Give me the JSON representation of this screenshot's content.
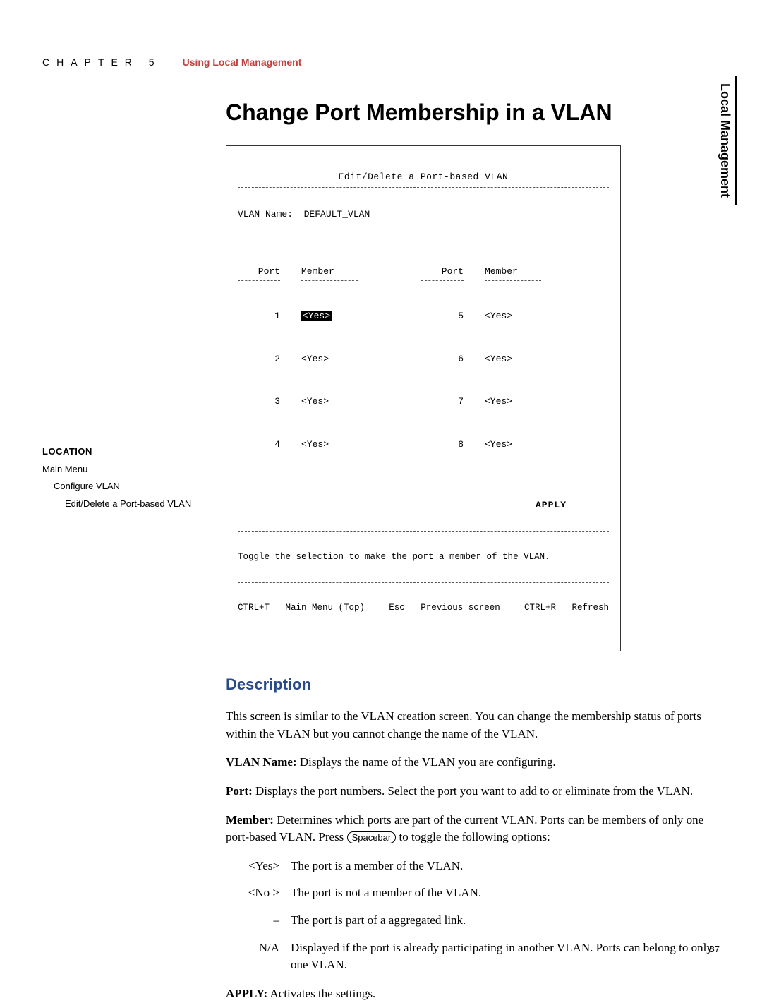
{
  "header": {
    "chapter_label": "CHAPTER 5",
    "chapter_topic": "Using Local Management"
  },
  "side_tab": "Local Management",
  "title": "Change Port Membership in a VLAN",
  "terminal": {
    "screen_title": "Edit/Delete a Port-based VLAN",
    "vlan_name_label": "VLAN Name:",
    "vlan_name_value": "DEFAULT_VLAN",
    "port_header": "Port",
    "member_header": "Member",
    "left_ports": [
      {
        "port": "1",
        "member": "<Yes>",
        "selected": true
      },
      {
        "port": "2",
        "member": "<Yes>"
      },
      {
        "port": "3",
        "member": "<Yes>"
      },
      {
        "port": "4",
        "member": "<Yes>"
      }
    ],
    "right_ports": [
      {
        "port": "5",
        "member": "<Yes>"
      },
      {
        "port": "6",
        "member": "<Yes>"
      },
      {
        "port": "7",
        "member": "<Yes>"
      },
      {
        "port": "8",
        "member": "<Yes>"
      }
    ],
    "apply_label": "APPLY",
    "hint": "Toggle the selection to make the port a member of the VLAN.",
    "nav_left": "CTRL+T = Main Menu (Top)",
    "nav_mid": "Esc = Previous screen",
    "nav_right": "CTRL+R = Refresh"
  },
  "description_heading": "Description",
  "location": {
    "heading": "LOCATION",
    "lvl1": "Main Menu",
    "lvl2": "Configure VLAN",
    "lvl3": "Edit/Delete a Port-based VLAN"
  },
  "desc": {
    "intro": "This screen is similar to the VLAN creation screen. You can change the membership status of ports within the VLAN but you cannot change the name of the VLAN.",
    "vlan_name_label": "VLAN Name:",
    "vlan_name_text": " Displays the name of the VLAN you are configuring.",
    "port_label": "Port:",
    "port_text": " Displays the port numbers. Select the port you want to add to or eliminate from the VLAN.",
    "member_label": "Member:",
    "member_text_a": " Determines which ports are part of the current VLAN. Ports can be members of only one port-based VLAN. Press ",
    "member_key": "Spacebar",
    "member_text_b": " to toggle the following options:",
    "options": [
      {
        "label": "<Yes>",
        "desc": "The port is a member of the VLAN."
      },
      {
        "label": "<No >",
        "desc": "The port is not a member of the VLAN."
      },
      {
        "label": "–",
        "desc": "The port is part of a aggregated link."
      },
      {
        "label": "N/A",
        "desc": "Displayed if the port is already participating in another VLAN. Ports can belong to only one VLAN."
      }
    ],
    "apply_label": "APPLY:",
    "apply_text": " Activates the settings."
  },
  "page_number": "87"
}
